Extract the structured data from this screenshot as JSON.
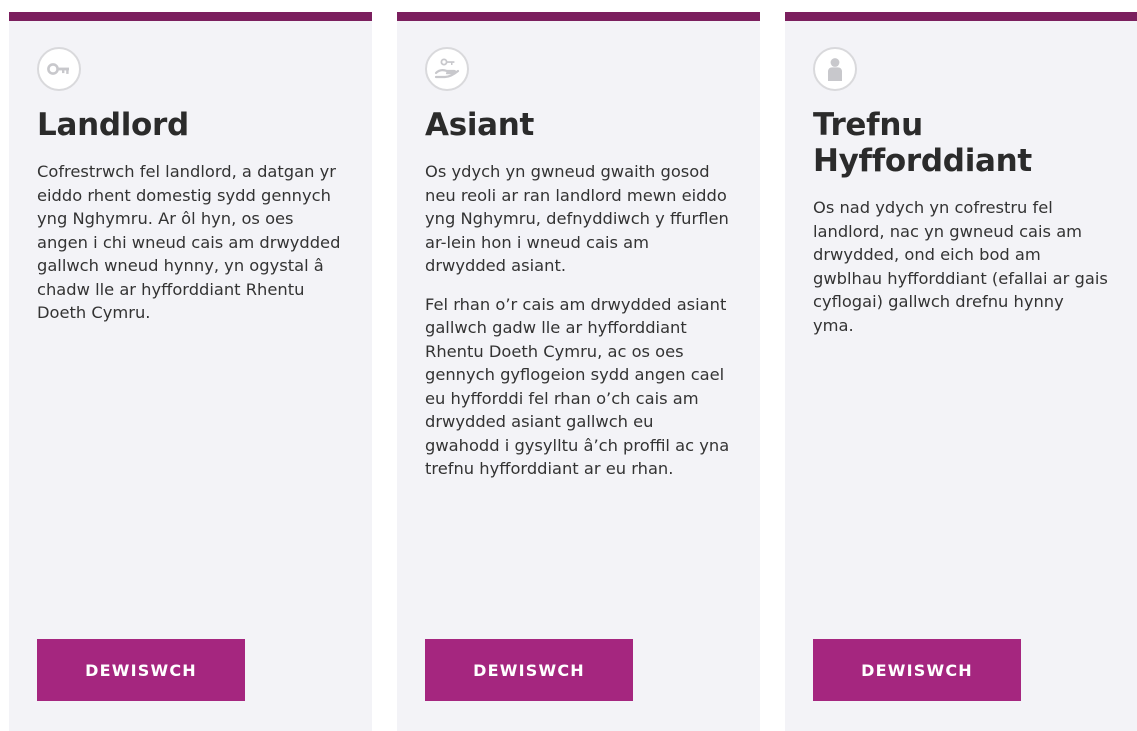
{
  "colors": {
    "top_border": "#7b1f5e",
    "button_bg": "#a5267f",
    "card_bg": "#f3f3f7",
    "icon_gray": "#c8c8cc"
  },
  "cards": [
    {
      "icon": "key-icon",
      "title": "Landlord",
      "paragraphs": [
        "Cofrestrwch fel landlord, a datgan yr eiddo rhent domestig sydd gennych yng Nghymru. Ar ôl hyn, os oes angen i chi wneud cais am drwydded gallwch wneud hynny, yn ogystal â chadw lle ar hyfforddiant Rhentu Doeth Cymru."
      ],
      "button_label": "DEWISWCH"
    },
    {
      "icon": "hand-key-icon",
      "title": "Asiant",
      "paragraphs": [
        "Os ydych yn gwneud gwaith gosod neu reoli ar ran landlord mewn eiddo yng Nghymru, defnyddiwch y ffurflen ar-lein hon i wneud cais am drwydded asiant.",
        "Fel rhan o’r cais am drwydded asiant gallwch gadw lle ar hyfforddiant Rhentu Doeth Cymru, ac os oes gennych gyflogeion sydd angen cael eu hyfforddi fel rhan o’ch cais am drwydded asiant gallwch eu gwahodd i gysylltu â’ch proffil ac yna trefnu hyfforddiant ar eu rhan."
      ],
      "button_label": "DEWISWCH"
    },
    {
      "icon": "person-icon",
      "title": "Trefnu Hyfforddiant",
      "paragraphs": [
        "Os nad ydych yn cofrestru fel landlord, nac yn gwneud cais am drwydded, ond eich bod am gwblhau hyfforddiant (efallai ar gais cyflogai) gallwch drefnu hynny yma."
      ],
      "button_label": "DEWISWCH"
    }
  ]
}
